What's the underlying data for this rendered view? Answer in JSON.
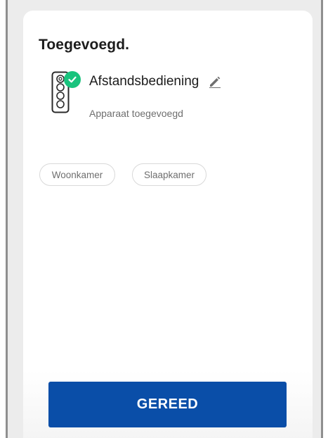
{
  "dialog": {
    "title": "Toegevoegd.",
    "device": {
      "name": "Afstandsbediening",
      "status": "Apparaat toegevoegd",
      "icon": "remote-control-icon",
      "badge_icon": "check-icon",
      "edit_icon": "pencil-icon"
    },
    "rooms": [
      {
        "label": "Woonkamer"
      },
      {
        "label": "Slaapkamer"
      }
    ],
    "done_label": "GEREED"
  },
  "colors": {
    "accent": "#0a4ea8",
    "success": "#19c37d",
    "title_text": "#1c1c1c",
    "muted_text": "#6e6e6e"
  }
}
